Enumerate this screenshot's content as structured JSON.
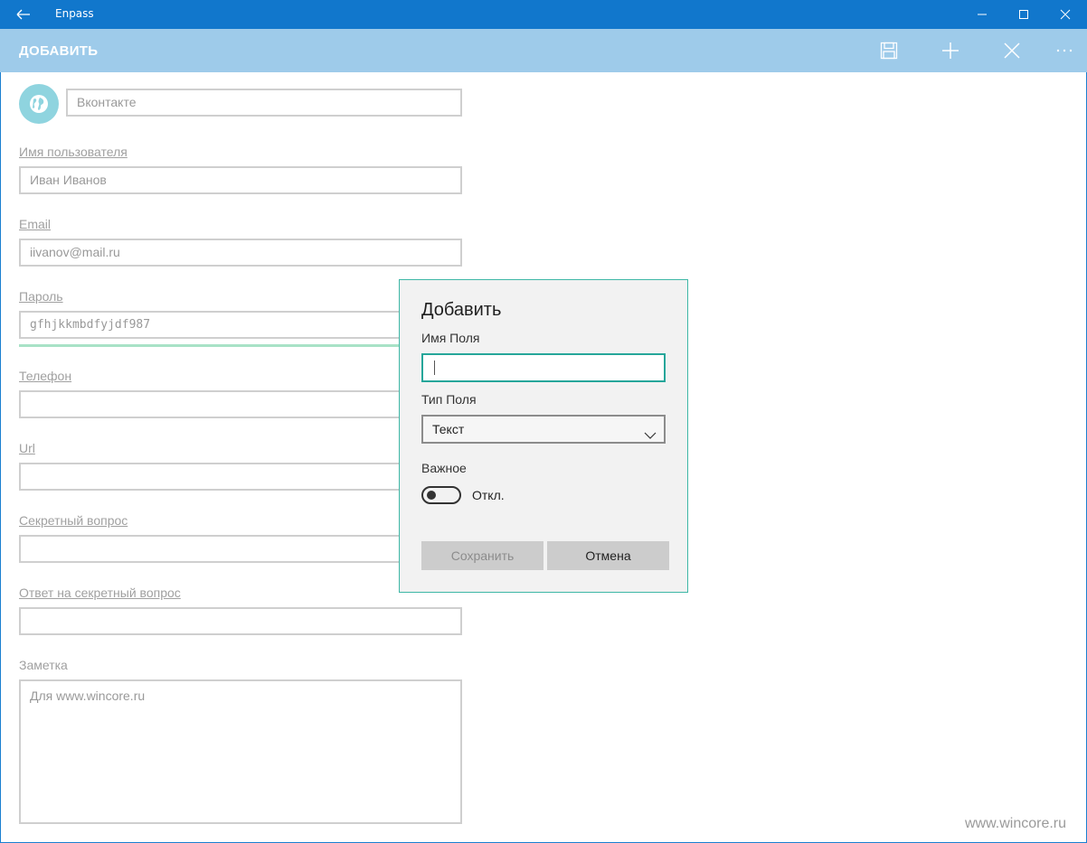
{
  "window": {
    "title": "Enpass",
    "back_icon": "back-arrow-icon",
    "controls": [
      "minimize-icon",
      "maximize-icon",
      "close-icon"
    ],
    "accent": "#1177cc"
  },
  "commandbar": {
    "heading": "ДОБАВИТЬ",
    "buttons": [
      "save-icon",
      "add-icon",
      "close-icon",
      "more-icon"
    ],
    "color": "#9ecbea"
  },
  "form": {
    "title_value": "Вконтакте",
    "avatar_icon": "globe-icon",
    "fields": [
      {
        "label": "Имя пользователя",
        "value": "Иван Иванов"
      },
      {
        "label": "Email",
        "value": "iivanov@mail.ru"
      },
      {
        "label": "Пароль",
        "value": "gfhjkkmbdfyjdf987"
      },
      {
        "label": "Телефон",
        "value": ""
      },
      {
        "label": "Url",
        "value": ""
      },
      {
        "label": "Секретный вопрос",
        "value": ""
      },
      {
        "label": "Ответ на секретный вопрос",
        "value": ""
      }
    ],
    "note_label": "Заметка",
    "note_value": "Для www.wincore.ru"
  },
  "dialog": {
    "title": "Добавить",
    "field_name_label": "Имя Поля",
    "field_name_value": "",
    "field_type_label": "Тип Поля",
    "field_type_value": "Текст",
    "important_label": "Важное",
    "toggle_state": "Откл.",
    "save_label": "Сохранить",
    "cancel_label": "Отмена",
    "border_color": "#3eb7a6"
  },
  "watermark": "www.wincore.ru"
}
